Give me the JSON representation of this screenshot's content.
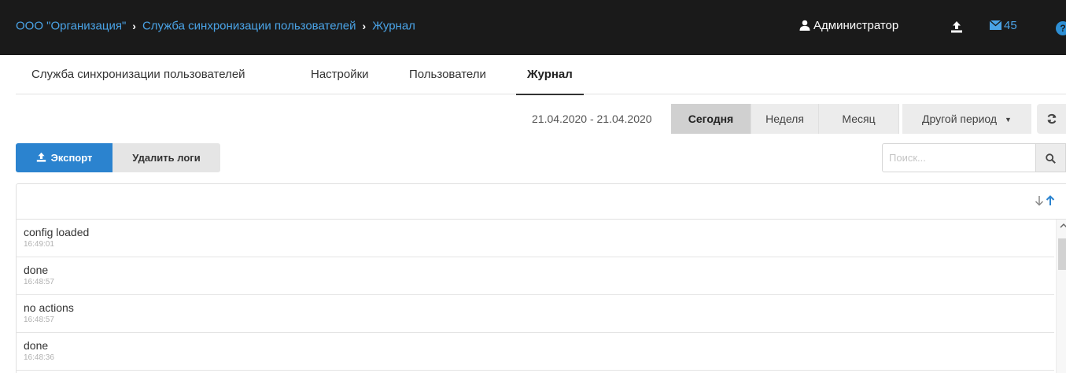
{
  "breadcrumb": {
    "items": [
      "ООО \"Организация\"",
      "Служба синхронизации пользователей",
      "Журнал"
    ],
    "separator": "›"
  },
  "topbar": {
    "user_label": "Администратор",
    "mail_count": "45",
    "help_glyph": "?",
    "icons": [
      "user-icon",
      "upload-icon",
      "envelope-icon",
      "help-icon"
    ]
  },
  "tabs": [
    {
      "label": "Служба синхронизации пользователей",
      "active": false
    },
    {
      "label": "Настройки",
      "active": false
    },
    {
      "label": "Пользователи",
      "active": false
    },
    {
      "label": "Журнал",
      "active": true
    }
  ],
  "period": {
    "range": "21.04.2020 - 21.04.2020",
    "buttons": [
      {
        "label": "Сегодня",
        "active": true
      },
      {
        "label": "Неделя",
        "active": false
      },
      {
        "label": "Месяц",
        "active": false
      }
    ],
    "other_label": "Другой период",
    "refresh_icon": "refresh-icon"
  },
  "actions": {
    "export_label": "Экспорт",
    "delete_label": "Удалить логи"
  },
  "search": {
    "placeholder": "Поиск...",
    "value": ""
  },
  "log": {
    "entries": [
      {
        "message": "config loaded",
        "time": "16:49:01"
      },
      {
        "message": "done",
        "time": "16:48:57"
      },
      {
        "message": "no actions",
        "time": "16:48:57"
      },
      {
        "message": "done",
        "time": "16:48:36"
      }
    ]
  },
  "colors": {
    "topbar_bg": "#1a1a1a",
    "link_blue": "#4aa3e6",
    "primary_button": "#2b83cf",
    "active_period": "#d0d0d0"
  }
}
